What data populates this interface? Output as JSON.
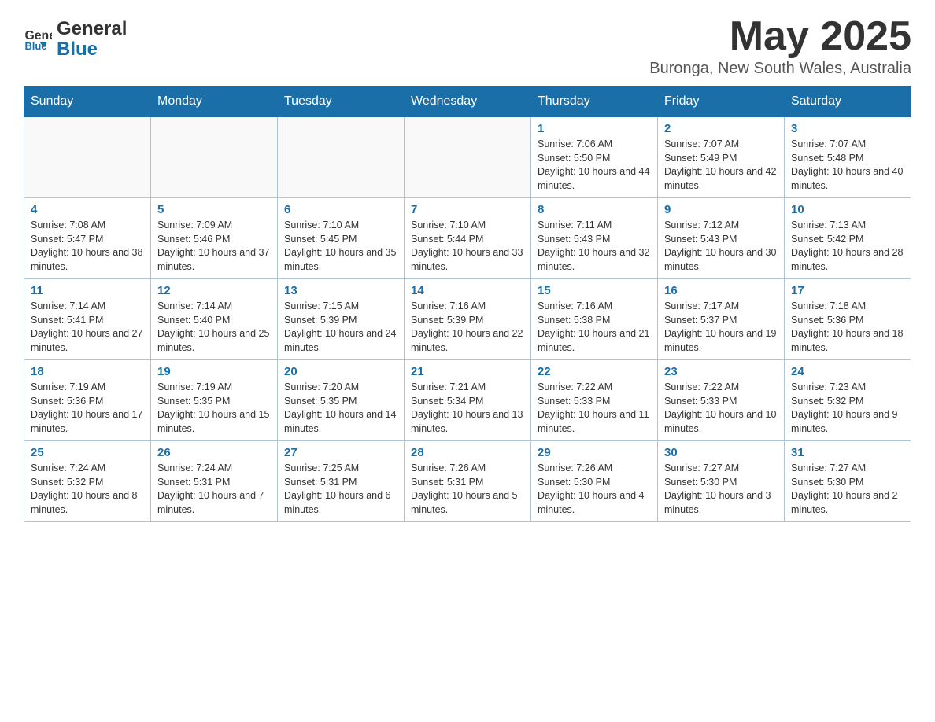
{
  "header": {
    "logo_text_general": "General",
    "logo_text_blue": "Blue",
    "month_title": "May 2025",
    "location": "Buronga, New South Wales, Australia"
  },
  "days_of_week": [
    "Sunday",
    "Monday",
    "Tuesday",
    "Wednesday",
    "Thursday",
    "Friday",
    "Saturday"
  ],
  "weeks": [
    {
      "days": [
        {
          "number": "",
          "info": ""
        },
        {
          "number": "",
          "info": ""
        },
        {
          "number": "",
          "info": ""
        },
        {
          "number": "",
          "info": ""
        },
        {
          "number": "1",
          "info": "Sunrise: 7:06 AM\nSunset: 5:50 PM\nDaylight: 10 hours and 44 minutes."
        },
        {
          "number": "2",
          "info": "Sunrise: 7:07 AM\nSunset: 5:49 PM\nDaylight: 10 hours and 42 minutes."
        },
        {
          "number": "3",
          "info": "Sunrise: 7:07 AM\nSunset: 5:48 PM\nDaylight: 10 hours and 40 minutes."
        }
      ]
    },
    {
      "days": [
        {
          "number": "4",
          "info": "Sunrise: 7:08 AM\nSunset: 5:47 PM\nDaylight: 10 hours and 38 minutes."
        },
        {
          "number": "5",
          "info": "Sunrise: 7:09 AM\nSunset: 5:46 PM\nDaylight: 10 hours and 37 minutes."
        },
        {
          "number": "6",
          "info": "Sunrise: 7:10 AM\nSunset: 5:45 PM\nDaylight: 10 hours and 35 minutes."
        },
        {
          "number": "7",
          "info": "Sunrise: 7:10 AM\nSunset: 5:44 PM\nDaylight: 10 hours and 33 minutes."
        },
        {
          "number": "8",
          "info": "Sunrise: 7:11 AM\nSunset: 5:43 PM\nDaylight: 10 hours and 32 minutes."
        },
        {
          "number": "9",
          "info": "Sunrise: 7:12 AM\nSunset: 5:43 PM\nDaylight: 10 hours and 30 minutes."
        },
        {
          "number": "10",
          "info": "Sunrise: 7:13 AM\nSunset: 5:42 PM\nDaylight: 10 hours and 28 minutes."
        }
      ]
    },
    {
      "days": [
        {
          "number": "11",
          "info": "Sunrise: 7:14 AM\nSunset: 5:41 PM\nDaylight: 10 hours and 27 minutes."
        },
        {
          "number": "12",
          "info": "Sunrise: 7:14 AM\nSunset: 5:40 PM\nDaylight: 10 hours and 25 minutes."
        },
        {
          "number": "13",
          "info": "Sunrise: 7:15 AM\nSunset: 5:39 PM\nDaylight: 10 hours and 24 minutes."
        },
        {
          "number": "14",
          "info": "Sunrise: 7:16 AM\nSunset: 5:39 PM\nDaylight: 10 hours and 22 minutes."
        },
        {
          "number": "15",
          "info": "Sunrise: 7:16 AM\nSunset: 5:38 PM\nDaylight: 10 hours and 21 minutes."
        },
        {
          "number": "16",
          "info": "Sunrise: 7:17 AM\nSunset: 5:37 PM\nDaylight: 10 hours and 19 minutes."
        },
        {
          "number": "17",
          "info": "Sunrise: 7:18 AM\nSunset: 5:36 PM\nDaylight: 10 hours and 18 minutes."
        }
      ]
    },
    {
      "days": [
        {
          "number": "18",
          "info": "Sunrise: 7:19 AM\nSunset: 5:36 PM\nDaylight: 10 hours and 17 minutes."
        },
        {
          "number": "19",
          "info": "Sunrise: 7:19 AM\nSunset: 5:35 PM\nDaylight: 10 hours and 15 minutes."
        },
        {
          "number": "20",
          "info": "Sunrise: 7:20 AM\nSunset: 5:35 PM\nDaylight: 10 hours and 14 minutes."
        },
        {
          "number": "21",
          "info": "Sunrise: 7:21 AM\nSunset: 5:34 PM\nDaylight: 10 hours and 13 minutes."
        },
        {
          "number": "22",
          "info": "Sunrise: 7:22 AM\nSunset: 5:33 PM\nDaylight: 10 hours and 11 minutes."
        },
        {
          "number": "23",
          "info": "Sunrise: 7:22 AM\nSunset: 5:33 PM\nDaylight: 10 hours and 10 minutes."
        },
        {
          "number": "24",
          "info": "Sunrise: 7:23 AM\nSunset: 5:32 PM\nDaylight: 10 hours and 9 minutes."
        }
      ]
    },
    {
      "days": [
        {
          "number": "25",
          "info": "Sunrise: 7:24 AM\nSunset: 5:32 PM\nDaylight: 10 hours and 8 minutes."
        },
        {
          "number": "26",
          "info": "Sunrise: 7:24 AM\nSunset: 5:31 PM\nDaylight: 10 hours and 7 minutes."
        },
        {
          "number": "27",
          "info": "Sunrise: 7:25 AM\nSunset: 5:31 PM\nDaylight: 10 hours and 6 minutes."
        },
        {
          "number": "28",
          "info": "Sunrise: 7:26 AM\nSunset: 5:31 PM\nDaylight: 10 hours and 5 minutes."
        },
        {
          "number": "29",
          "info": "Sunrise: 7:26 AM\nSunset: 5:30 PM\nDaylight: 10 hours and 4 minutes."
        },
        {
          "number": "30",
          "info": "Sunrise: 7:27 AM\nSunset: 5:30 PM\nDaylight: 10 hours and 3 minutes."
        },
        {
          "number": "31",
          "info": "Sunrise: 7:27 AM\nSunset: 5:30 PM\nDaylight: 10 hours and 2 minutes."
        }
      ]
    }
  ]
}
